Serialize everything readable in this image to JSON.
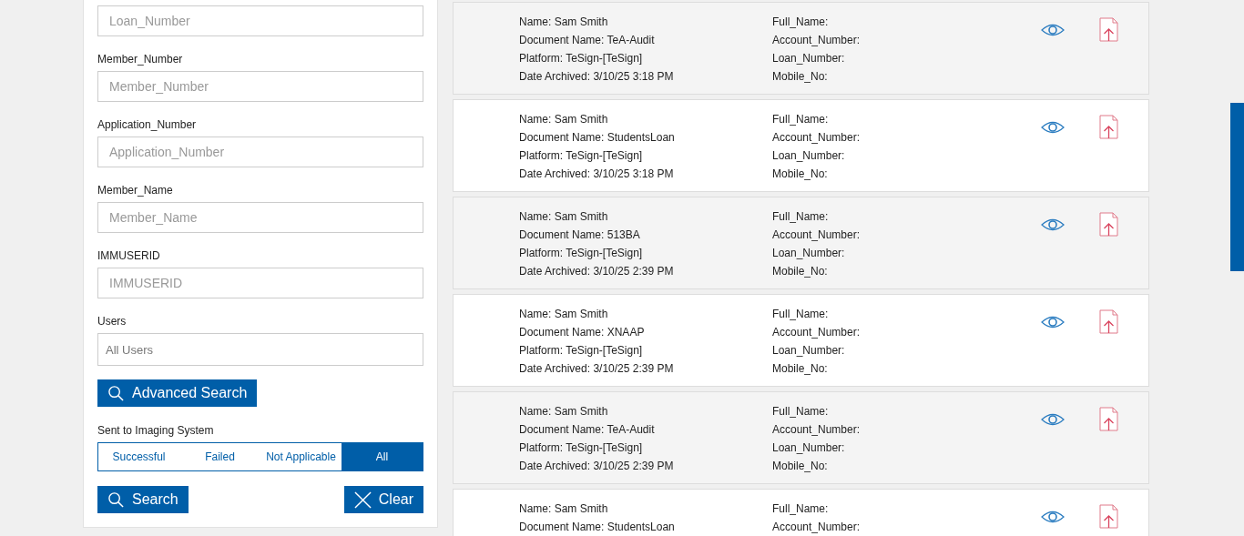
{
  "search_panel": {
    "fields": [
      {
        "placeholder": "Loan_Number"
      },
      {
        "label": "Member_Number",
        "placeholder": "Member_Number"
      },
      {
        "label": "Application_Number",
        "placeholder": "Application_Number"
      },
      {
        "label": "Member_Name",
        "placeholder": "Member_Name"
      },
      {
        "label": "IMMUSERID",
        "placeholder": "IMMUSERID"
      },
      {
        "label": "Users",
        "value": "All Users"
      }
    ],
    "advanced_search_button": "Advanced Search",
    "imaging_filter": {
      "label": "Sent to Imaging System",
      "options": [
        {
          "label": "Successful",
          "selected": false
        },
        {
          "label": "Failed",
          "selected": false
        },
        {
          "label": "Not Applicable",
          "selected": false
        },
        {
          "label": "All",
          "selected": true
        }
      ]
    },
    "search_button": "Search",
    "clear_button": "Clear"
  },
  "results": [
    {
      "details": [
        "Name: Sam Smith",
        "Document Name: TeA-Audit",
        "Platform: TeSign-[TeSign]",
        "Date Archived: 3/10/25 3:18 PM"
      ],
      "fields": [
        "Full_Name:",
        "Account_Number:",
        "Loan_Number:",
        "Mobile_No:"
      ]
    },
    {
      "details": [
        "Name: Sam Smith",
        "Document Name: StudentsLoan",
        "Platform: TeSign-[TeSign]",
        "Date Archived: 3/10/25 3:18 PM"
      ],
      "fields": [
        "Full_Name:",
        "Account_Number:",
        "Loan_Number:",
        "Mobile_No:"
      ]
    },
    {
      "details": [
        "Name: Sam Smith",
        "Document Name: 513BA",
        "Platform: TeSign-[TeSign]",
        "Date Archived: 3/10/25 2:39 PM"
      ],
      "fields": [
        "Full_Name:",
        "Account_Number:",
        "Loan_Number:",
        "Mobile_No:"
      ]
    },
    {
      "details": [
        "Name: Sam Smith",
        "Document Name: XNAAP",
        "Platform: TeSign-[TeSign]",
        "Date Archived: 3/10/25 2:39 PM"
      ],
      "fields": [
        "Full_Name:",
        "Account_Number:",
        "Loan_Number:",
        "Mobile_No:"
      ]
    },
    {
      "details": [
        "Name: Sam Smith",
        "Document Name: TeA-Audit",
        "Platform: TeSign-[TeSign]",
        "Date Archived: 3/10/25 2:39 PM"
      ],
      "fields": [
        "Full_Name:",
        "Account_Number:",
        "Loan_Number:",
        "Mobile_No:"
      ]
    },
    {
      "details": [
        "Name: Sam Smith",
        "Document Name: StudentsLoan"
      ],
      "fields": [
        "Full_Name:",
        "Account_Number:"
      ]
    }
  ]
}
